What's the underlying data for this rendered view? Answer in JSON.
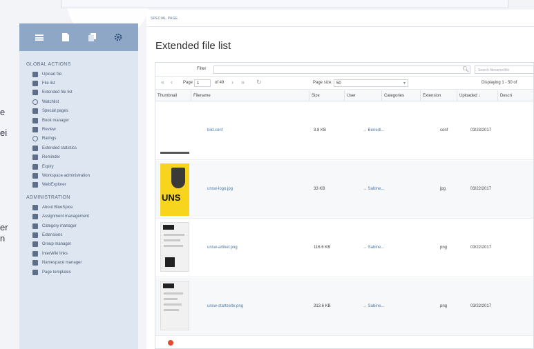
{
  "left_fragments": [
    "e",
    "ei",
    "er",
    "n"
  ],
  "breadcrumb": "SPECIAL PAGE",
  "page_title": "Extended file list",
  "sidebar": {
    "top_icons": [
      "list-icon",
      "document-icon",
      "copy-icon",
      "gear-icon"
    ],
    "global_section": "GLOBAL ACTIONS",
    "global_items": [
      "Upload file",
      "File list",
      "Extended file list",
      "Watchlist",
      "Special pages",
      "Book manager",
      "Review",
      "Ratings",
      "Extended statistics",
      "Reminder",
      "Expiry",
      "Workspace administration",
      "WebExplorer"
    ],
    "admin_section": "ADMINISTRATION",
    "admin_items": [
      "About BlueSpice",
      "Assignment management",
      "Category manager",
      "Extensions",
      "Group manager",
      "InterWiki links",
      "Namespace manager",
      "Page templates"
    ]
  },
  "grid": {
    "filter_label": "Filter",
    "search_placeholder": "Search filename/title",
    "pager": {
      "page_label": "Page",
      "page_value": "1",
      "of_label": "of 49",
      "page_size_label": "Page size:",
      "page_size_value": "50",
      "display_text": "Displaying 1 - 50 of"
    },
    "columns": [
      "Thumbnail",
      "Filename",
      "Size",
      "User",
      "Categories",
      "Extension",
      "Uploaded ↓",
      "Descri"
    ],
    "rows": [
      {
        "filename": "bild.conf",
        "size": "3.8 KB",
        "user": "→ Benedi...",
        "extension": "conf",
        "uploaded": "03/23/2017"
      },
      {
        "filename": "unsw-logo.jpg",
        "size": "33 KB",
        "user": "→ Sabine...",
        "extension": "jpg",
        "uploaded": "03/22/2017"
      },
      {
        "filename": "unsw-artikel.png",
        "size": "116.6 KB",
        "user": "→ Sabine...",
        "extension": "png",
        "uploaded": "03/22/2017"
      },
      {
        "filename": "unsw-startseite.png",
        "size": "313.6 KB",
        "user": "→ Sabine...",
        "extension": "png",
        "uploaded": "03/22/2017"
      }
    ],
    "unsw_logo_text": "UNS"
  }
}
